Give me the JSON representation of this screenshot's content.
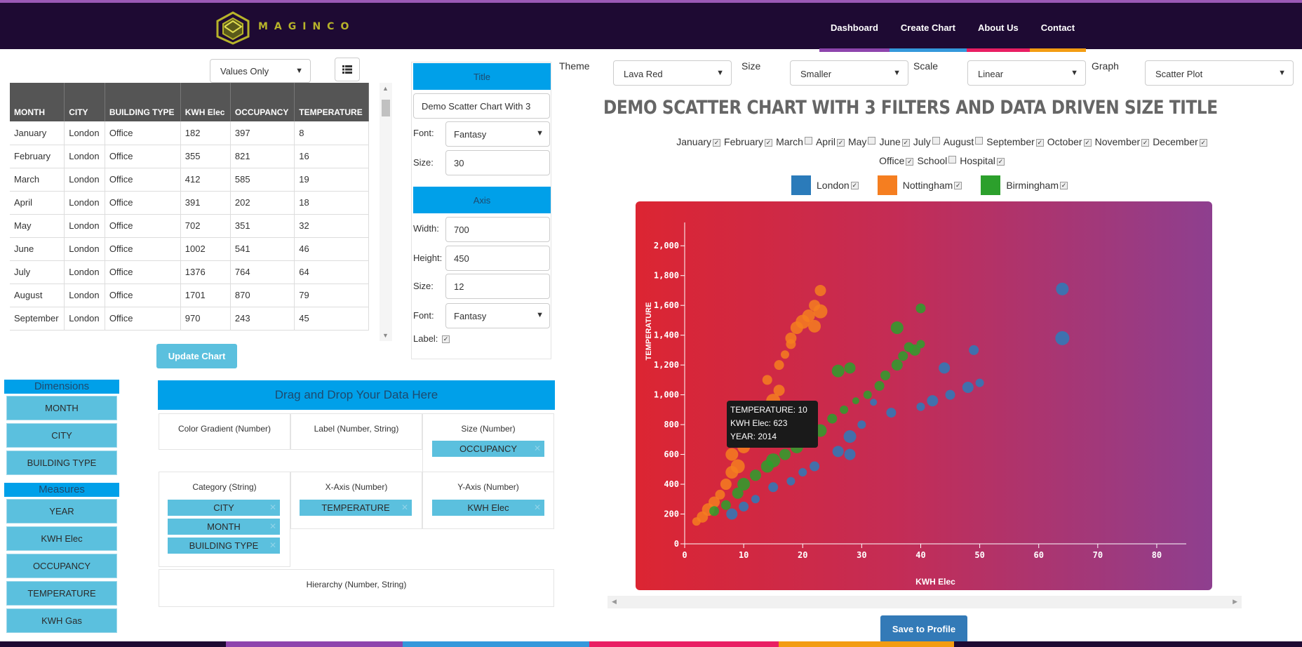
{
  "brand": "MAGINCO",
  "nav": [
    {
      "label": "Dashboard",
      "color": "#8e44ad"
    },
    {
      "label": "Create Chart",
      "color": "#3498db"
    },
    {
      "label": "About Us",
      "color": "#e91e63"
    },
    {
      "label": "Contact",
      "color": "#f39c12"
    }
  ],
  "table": {
    "view_select": "Values Only",
    "headers": [
      "MONTH",
      "CITY",
      "BUILDING TYPE",
      "KWH Elec",
      "OCCUPANCY",
      "TEMPERATURE"
    ],
    "rows": [
      [
        "January",
        "London",
        "Office",
        "182",
        "397",
        "8"
      ],
      [
        "February",
        "London",
        "Office",
        "355",
        "821",
        "16"
      ],
      [
        "March",
        "London",
        "Office",
        "412",
        "585",
        "19"
      ],
      [
        "April",
        "London",
        "Office",
        "391",
        "202",
        "18"
      ],
      [
        "May",
        "London",
        "Office",
        "702",
        "351",
        "32"
      ],
      [
        "June",
        "London",
        "Office",
        "1002",
        "541",
        "46"
      ],
      [
        "July",
        "London",
        "Office",
        "1376",
        "764",
        "64"
      ],
      [
        "August",
        "London",
        "Office",
        "1701",
        "870",
        "79"
      ],
      [
        "September",
        "London",
        "Office",
        "970",
        "243",
        "45"
      ]
    ]
  },
  "update_chart": "Update Chart",
  "dimensions": {
    "title": "Dimensions",
    "items": [
      "MONTH",
      "CITY",
      "BUILDING TYPE"
    ]
  },
  "measures": {
    "title": "Measures",
    "items": [
      "YEAR",
      "KWH Elec",
      "OCCUPANCY",
      "TEMPERATURE",
      "KWH Gas"
    ]
  },
  "dropzone": {
    "title": "Drag and Drop Your Data Here",
    "color_gradient": "Color Gradient (Number)",
    "label": "Label (Number, String)",
    "size": "Size (Number)",
    "size_chip": "OCCUPANCY",
    "category": "Category (String)",
    "category_chips": [
      "CITY",
      "MONTH",
      "BUILDING TYPE"
    ],
    "x_axis": "X-Axis (Number)",
    "x_chip": "TEMPERATURE",
    "y_axis": "Y-Axis (Number)",
    "y_chip": "KWH Elec",
    "hierarchy": "Hierarchy (Number, String)"
  },
  "panel": {
    "title_hdr": "Title",
    "title_value": "Demo Scatter Chart With 3",
    "font_label": "Font:",
    "font_value": "Fantasy",
    "size_label": "Size:",
    "title_size": "30",
    "axis_hdr": "Axis",
    "width_label": "Width:",
    "width_value": "700",
    "height_label": "Height:",
    "height_value": "450",
    "axis_size": "12",
    "axis_font": "Fantasy",
    "label_label": "Label:"
  },
  "controls": {
    "theme_label": "Theme",
    "theme": "Lava Red",
    "size_label": "Size",
    "size": "Smaller",
    "scale_label": "Scale",
    "scale": "Linear",
    "graph_label": "Graph",
    "graph": "Scatter Plot"
  },
  "filters": {
    "months": [
      {
        "label": "January",
        "checked": true
      },
      {
        "label": "February",
        "checked": true
      },
      {
        "label": "March",
        "checked": false
      },
      {
        "label": "April",
        "checked": true
      },
      {
        "label": "May",
        "checked": false
      },
      {
        "label": "June",
        "checked": true
      },
      {
        "label": "July",
        "checked": false
      },
      {
        "label": "August",
        "checked": false
      },
      {
        "label": "September",
        "checked": true
      },
      {
        "label": "October",
        "checked": true
      },
      {
        "label": "November",
        "checked": true
      },
      {
        "label": "December",
        "checked": true
      }
    ],
    "building_types": [
      {
        "label": "Office",
        "checked": true
      },
      {
        "label": "School",
        "checked": false
      },
      {
        "label": "Hospital",
        "checked": true
      }
    ]
  },
  "tooltip": {
    "line1": "TEMPERATURE: 10",
    "line2": "KWH Elec: 623",
    "line3": "YEAR: 2014"
  },
  "save_button": "Save to Profile",
  "chart_data": {
    "type": "scatter",
    "title": "DEMO SCATTER CHART WITH 3 FILTERS AND DATA DRIVEN SIZE TITLE",
    "xlabel": "KWH Elec",
    "ylabel": "TEMPERATURE",
    "xlim": [
      0,
      85
    ],
    "ylim": [
      0,
      2100
    ],
    "x_ticks": [
      0,
      10,
      20,
      30,
      40,
      50,
      60,
      70,
      80
    ],
    "y_ticks": [
      0,
      200,
      400,
      600,
      800,
      1000,
      1200,
      1400,
      1600,
      1800,
      2000
    ],
    "background_gradient": [
      "#dc2532",
      "#8e3f8f"
    ],
    "series": [
      {
        "name": "London",
        "color": "#2b7bba",
        "points": [
          [
            8,
            200,
            8
          ],
          [
            10,
            250,
            7
          ],
          [
            12,
            300,
            6
          ],
          [
            15,
            380,
            7
          ],
          [
            18,
            420,
            6
          ],
          [
            20,
            480,
            6
          ],
          [
            22,
            520,
            7
          ],
          [
            26,
            620,
            8
          ],
          [
            28,
            720,
            9
          ],
          [
            30,
            800,
            6
          ],
          [
            35,
            880,
            7
          ],
          [
            40,
            920,
            6
          ],
          [
            42,
            960,
            8
          ],
          [
            45,
            1000,
            7
          ],
          [
            48,
            1050,
            8
          ],
          [
            50,
            1080,
            6
          ],
          [
            44,
            1180,
            8
          ],
          [
            49,
            1300,
            7
          ],
          [
            64,
            1380,
            10
          ],
          [
            64,
            1710,
            9
          ],
          [
            32,
            950,
            5
          ],
          [
            28,
            600,
            8
          ]
        ]
      },
      {
        "name": "Nottingham",
        "color": "#f57e20",
        "points": [
          [
            2,
            150,
            6
          ],
          [
            3,
            180,
            8
          ],
          [
            4,
            230,
            9
          ],
          [
            5,
            280,
            8
          ],
          [
            6,
            330,
            7
          ],
          [
            7,
            400,
            8
          ],
          [
            8,
            480,
            9
          ],
          [
            9,
            520,
            10
          ],
          [
            8,
            600,
            9
          ],
          [
            10,
            650,
            9
          ],
          [
            12,
            760,
            8
          ],
          [
            14,
            880,
            9
          ],
          [
            15,
            960,
            10
          ],
          [
            16,
            1030,
            8
          ],
          [
            14,
            1100,
            7
          ],
          [
            16,
            1200,
            7
          ],
          [
            17,
            1270,
            6
          ],
          [
            18,
            1340,
            7
          ],
          [
            18,
            1380,
            8
          ],
          [
            19,
            1450,
            9
          ],
          [
            20,
            1490,
            10
          ],
          [
            21,
            1530,
            9
          ],
          [
            22,
            1460,
            9
          ],
          [
            23,
            1560,
            10
          ],
          [
            22,
            1600,
            8
          ],
          [
            23,
            1700,
            8
          ]
        ]
      },
      {
        "name": "Birmingham",
        "color": "#2ca02c",
        "points": [
          [
            5,
            220,
            7
          ],
          [
            7,
            260,
            7
          ],
          [
            9,
            340,
            8
          ],
          [
            10,
            400,
            9
          ],
          [
            12,
            460,
            8
          ],
          [
            14,
            520,
            9
          ],
          [
            15,
            560,
            10
          ],
          [
            17,
            600,
            8
          ],
          [
            19,
            650,
            9
          ],
          [
            21,
            700,
            10
          ],
          [
            23,
            760,
            9
          ],
          [
            25,
            840,
            7
          ],
          [
            27,
            900,
            6
          ],
          [
            29,
            960,
            5
          ],
          [
            31,
            1000,
            6
          ],
          [
            33,
            1060,
            7
          ],
          [
            34,
            1130,
            7
          ],
          [
            36,
            1200,
            8
          ],
          [
            37,
            1260,
            7
          ],
          [
            39,
            1300,
            8
          ],
          [
            38,
            1320,
            7
          ],
          [
            40,
            1340,
            6
          ],
          [
            36,
            1450,
            9
          ],
          [
            40,
            1580,
            7
          ],
          [
            26,
            1160,
            9
          ],
          [
            28,
            1180,
            8
          ]
        ]
      }
    ]
  }
}
